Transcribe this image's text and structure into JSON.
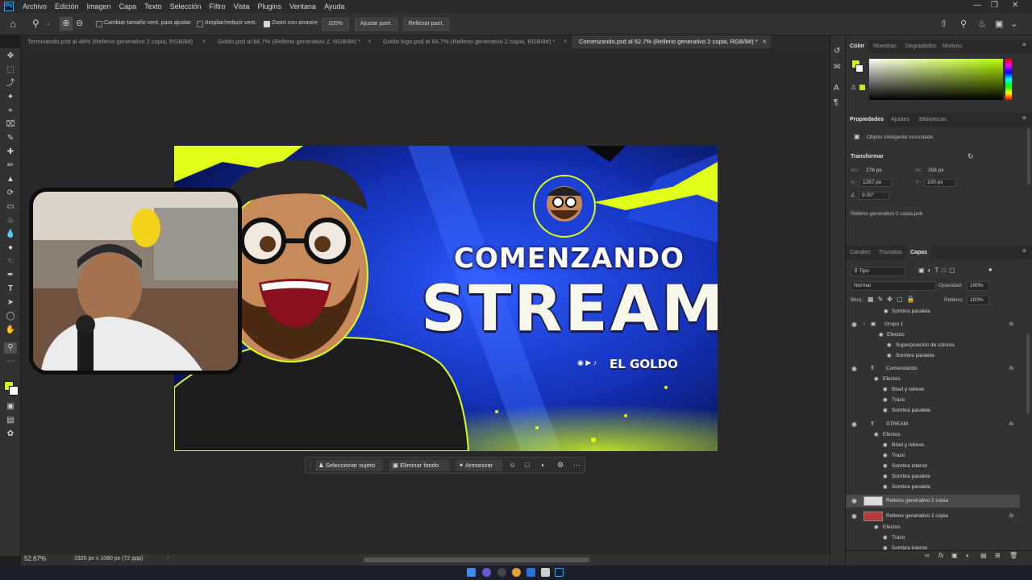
{
  "app": {
    "logo": "Ps",
    "menu": [
      "Archivo",
      "Edición",
      "Imagen",
      "Capa",
      "Texto",
      "Selección",
      "Filtro",
      "Vista",
      "Plugins",
      "Ventana",
      "Ayuda"
    ]
  },
  "options": {
    "resize_windows_label": "Cambiar tamaño vent. para ajustar",
    "zoom_all_label": "Ampliar/reducir vent.",
    "scrubby_zoom_label": "Zoom con arrastre",
    "zoom_value": "100%",
    "fit_screen_label": "Ajustar pant.",
    "fill_screen_label": "Rellenar pant."
  },
  "tabs": [
    {
      "label": "Terminando.psd al 48% (Relleno generativo 2 copia, RGB/8#)"
    },
    {
      "label": "Goldo.psd al 66.7% (Relleno generativo 2, RGB/8#) *"
    },
    {
      "label": "Goldo logo.psd al 66.7% (Relleno generativo 2 copia, RGB/8#) *"
    },
    {
      "label": "Comenzando.psd al 52.7% (Relleno generativo 2 copia, RGB/8#) *"
    }
  ],
  "artwork": {
    "title_top": "COMENZANDO",
    "title_main": "STREAM",
    "brand": "EL GOLDO"
  },
  "context_bar": {
    "select_subject": "Seleccionar sujeto",
    "remove_bg": "Eliminar fondo",
    "harmonize": "Armonizar"
  },
  "status": {
    "zoom": "52.67%",
    "doc_size": "1920 px x 1080 px (72 ppp)"
  },
  "color_panel": {
    "tabs": [
      "Color",
      "Muestras",
      "Degradados",
      "Motivos"
    ],
    "foreground": "#d4f21a"
  },
  "properties": {
    "tabs": [
      "Propiedades",
      "Ajustes",
      "Bibliotecas"
    ],
    "type_label": "Objeto inteligente incrustado",
    "transform_label": "Transformar",
    "w_label": "An.:",
    "w_value": "276 px",
    "h_label": "Al.:",
    "h_value": "258 px",
    "x_label": "X:",
    "x_value": "1267 px",
    "y_label": "Y:",
    "y_value": "100 px",
    "angle_value": "0.00°",
    "file_name": "Relleno generativo 2 copia.psb"
  },
  "layers_panel": {
    "tabs": [
      "Canales",
      "Trazados",
      "Capas"
    ],
    "filter_kind": "Tipo",
    "blend_mode": "Normal",
    "opacity_label": "Opacidad:",
    "opacity_value": "100%",
    "lock_label": "Bloq.:",
    "fill_label": "Relleno:",
    "fill_value": "100%",
    "rows": [
      {
        "label": "Sombra paralela",
        "type": "effect"
      },
      {
        "label": "Grupo 1",
        "type": "group"
      },
      {
        "label": "Efectos",
        "type": "effects"
      },
      {
        "label": "Superposición de colores",
        "type": "effect"
      },
      {
        "label": "Sombra paralela",
        "type": "effect"
      },
      {
        "label": "Comenzando",
        "type": "text"
      },
      {
        "label": "Efectos",
        "type": "effects"
      },
      {
        "label": "Bisel y relieve",
        "type": "effect"
      },
      {
        "label": "Trazo",
        "type": "effect"
      },
      {
        "label": "Sombra paralela",
        "type": "effect"
      },
      {
        "label": "STREAM",
        "type": "text"
      },
      {
        "label": "Efectos",
        "type": "effects"
      },
      {
        "label": "Bisel y relieve",
        "type": "effect"
      },
      {
        "label": "Trazo",
        "type": "effect"
      },
      {
        "label": "Sombra interior",
        "type": "effect"
      },
      {
        "label": "Sombra paralela",
        "type": "effect"
      },
      {
        "label": "Sombra paralela",
        "type": "effect"
      },
      {
        "label": "Relleno generativo 2 copia",
        "type": "smart",
        "selected": true
      },
      {
        "label": "Relleno generativo 2 copia",
        "type": "smart"
      },
      {
        "label": "Efectos",
        "type": "effects"
      },
      {
        "label": "Trazo",
        "type": "effect"
      },
      {
        "label": "Sombra interior",
        "type": "effect"
      }
    ]
  }
}
